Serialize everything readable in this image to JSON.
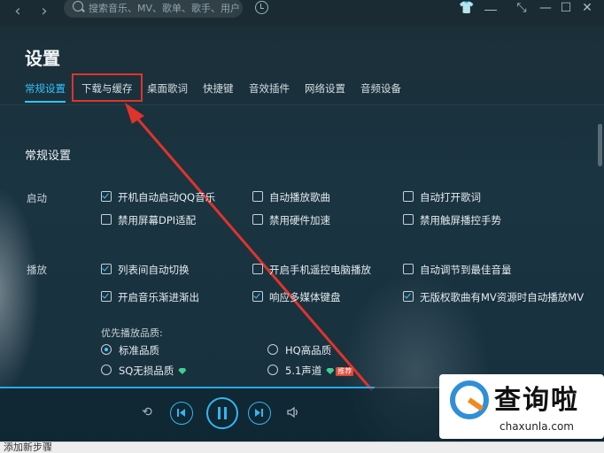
{
  "header": {
    "back_glyph": "‹",
    "forward_glyph": "›",
    "search_placeholder": "搜索音乐、MV、歌单、歌手、用户",
    "window_buttons": [
      "shirt-icon",
      "mini-mode-icon",
      "minimize-icon",
      "maximize-icon",
      "close-icon"
    ]
  },
  "settings": {
    "title": "设置",
    "tabs": [
      {
        "label": "常规设置",
        "active": true
      },
      {
        "label": "下载与缓存",
        "active": false,
        "highlighted": true
      },
      {
        "label": "桌面歌词",
        "active": false
      },
      {
        "label": "快捷键",
        "active": false
      },
      {
        "label": "音效插件",
        "active": false
      },
      {
        "label": "网络设置",
        "active": false
      },
      {
        "label": "音频设备",
        "active": false
      }
    ],
    "section_title": "常规设置",
    "groups": {
      "startup": {
        "label": "启动",
        "options": [
          {
            "label": "开机自动启动QQ音乐",
            "checked": true
          },
          {
            "label": "自动播放歌曲",
            "checked": false
          },
          {
            "label": "自动打开歌词",
            "checked": false
          },
          {
            "label": "禁用屏幕DPI适配",
            "checked": false
          },
          {
            "label": "禁用硬件加速",
            "checked": false
          },
          {
            "label": "禁用触屏播控手势",
            "checked": false
          }
        ]
      },
      "playback": {
        "label": "播放",
        "options": [
          {
            "label": "列表间自动切换",
            "checked": true
          },
          {
            "label": "开启手机遥控电脑播放",
            "checked": false
          },
          {
            "label": "自动调节到最佳音量",
            "checked": false
          },
          {
            "label": "开启音乐渐进渐出",
            "checked": true
          },
          {
            "label": "响应多媒体键盘",
            "checked": true
          },
          {
            "label": "无版权歌曲有MV资源时自动播放MV",
            "checked": true
          }
        ],
        "quality_label": "优先播放品质:",
        "quality_options": [
          {
            "label": "标准品质",
            "selected": true
          },
          {
            "label": "HQ高品质",
            "selected": false
          },
          {
            "label": "SQ无损品质",
            "selected": false,
            "badge": "gem-icon"
          },
          {
            "label": "5.1声道",
            "selected": false,
            "badge": "gem-icon",
            "tag": "推荐"
          }
        ]
      }
    }
  },
  "player": {
    "progress": 0.62,
    "controls": [
      "loop-icon",
      "previous-icon",
      "pause-icon",
      "next-icon",
      "volume-icon"
    ]
  },
  "watermark": {
    "cn": "查询啦",
    "en": "chaxunla.com"
  },
  "bottom_strip": {
    "text": "添加新步骤"
  },
  "colors": {
    "accent": "#33c3ff",
    "highlight_box": "#e0332b",
    "arrow": "#e0332b"
  }
}
